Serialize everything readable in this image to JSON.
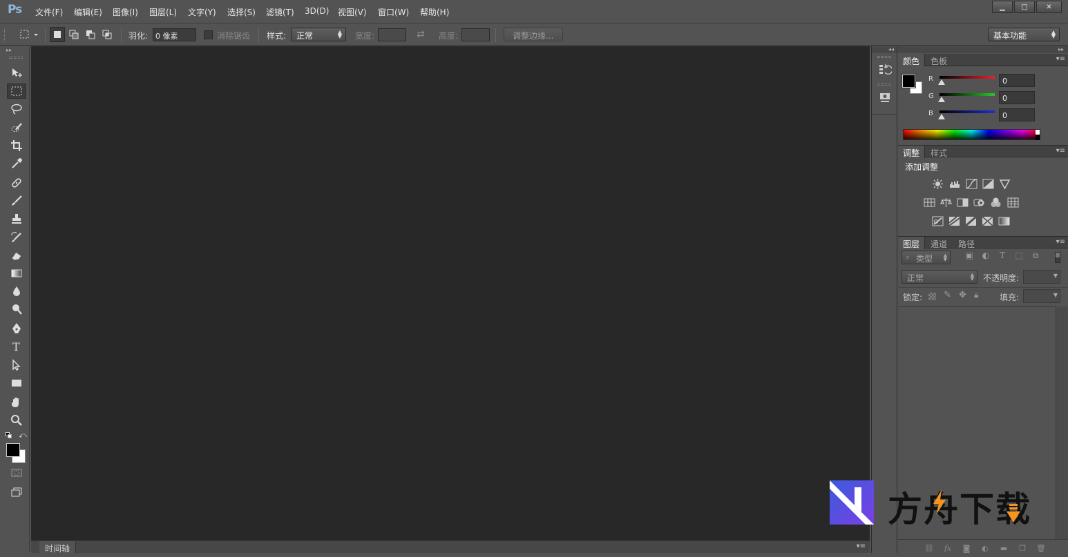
{
  "app": {
    "logo": "Ps"
  },
  "menu": [
    "文件(F)",
    "编辑(E)",
    "图像(I)",
    "图层(L)",
    "文字(Y)",
    "选择(S)",
    "滤镜(T)",
    "3D(D)",
    "视图(V)",
    "窗口(W)",
    "帮助(H)"
  ],
  "options": {
    "feather_label": "羽化:",
    "feather_value": "0 像素",
    "antialias_label": "消除锯齿",
    "style_label": "样式:",
    "style_value": "正常",
    "width_label": "宽度:",
    "height_label": "高度:",
    "refine_edge": "调整边缘...",
    "workspace": "基本功能"
  },
  "timeline": {
    "tab": "时间轴"
  },
  "color_panel": {
    "tabs": [
      "颜色",
      "色板"
    ],
    "channels": [
      {
        "name": "R",
        "value": "0",
        "color": "#e8232b"
      },
      {
        "name": "G",
        "value": "0",
        "color": "#2ec32b"
      },
      {
        "name": "B",
        "value": "0",
        "color": "#1b2fd0"
      }
    ]
  },
  "adjust_panel": {
    "tabs": [
      "调整",
      "样式"
    ],
    "title": "添加调整"
  },
  "layers_panel": {
    "tabs": [
      "图层",
      "通道",
      "路径"
    ],
    "kind_filter": "类型",
    "blend_mode": "正常",
    "opacity_label": "不透明度:",
    "lock_label": "锁定:",
    "fill_label": "填充:"
  },
  "watermark": {
    "text": "方舟下载",
    "accent": "#f7941d"
  }
}
